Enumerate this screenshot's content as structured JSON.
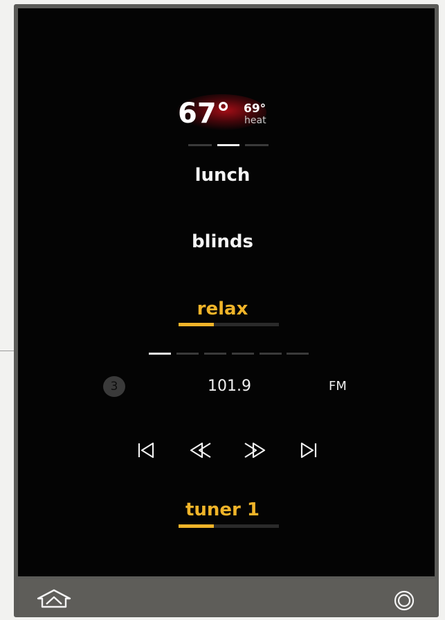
{
  "climate": {
    "current_temp": "67°",
    "set_temp": "69°",
    "mode": "heat"
  },
  "scenes": {
    "lunch": "lunch",
    "blinds": "blinds",
    "active": "relax",
    "active_level": 0.35
  },
  "tuner": {
    "preset": "3",
    "frequency": "101.9",
    "band": "FM",
    "source": "tuner 1",
    "source_level": 0.35
  },
  "icons": {
    "prev": "skip-previous-icon",
    "rewind": "rewind-icon",
    "forward": "fast-forward-icon",
    "next": "skip-next-icon",
    "home": "home-icon",
    "menu": "circle-menu-icon"
  },
  "colors": {
    "accent": "#f0b429",
    "screen": "#040404",
    "frame": "#5b5b58",
    "glow": "#be0f19"
  }
}
